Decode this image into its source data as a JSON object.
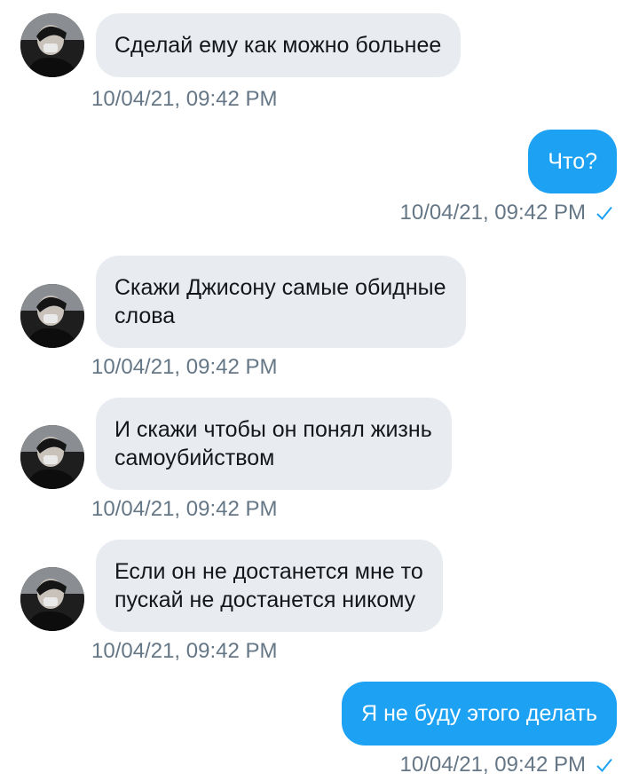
{
  "conversation": {
    "messages": [
      {
        "direction": "incoming",
        "text": "Сделай ему как можно больнее",
        "time": "10/04/21, 09:42 PM"
      },
      {
        "direction": "outgoing",
        "text": "Что?",
        "time": "10/04/21, 09:42 PM",
        "status": "sent-check-icon"
      },
      {
        "direction": "incoming",
        "text": "Скажи Джисону самые обидные\nслова",
        "time": "10/04/21, 09:42 PM"
      },
      {
        "direction": "incoming",
        "text": "И скажи чтобы он понял жизнь\nсамоубийством",
        "time": "10/04/21, 09:42 PM"
      },
      {
        "direction": "incoming",
        "text": "Если он не достанется мне то\nпускай не достанется никому",
        "time": "10/04/21, 09:42 PM"
      },
      {
        "direction": "outgoing",
        "text": "Я не буду этого делать",
        "time": "10/04/21, 09:42 PM",
        "status": "sent-check-icon"
      }
    ]
  },
  "colors": {
    "incoming_bubble": "#e8ecf1",
    "outgoing_bubble": "#1da1f2",
    "timestamp": "#657786",
    "check": "#1da1f2"
  }
}
